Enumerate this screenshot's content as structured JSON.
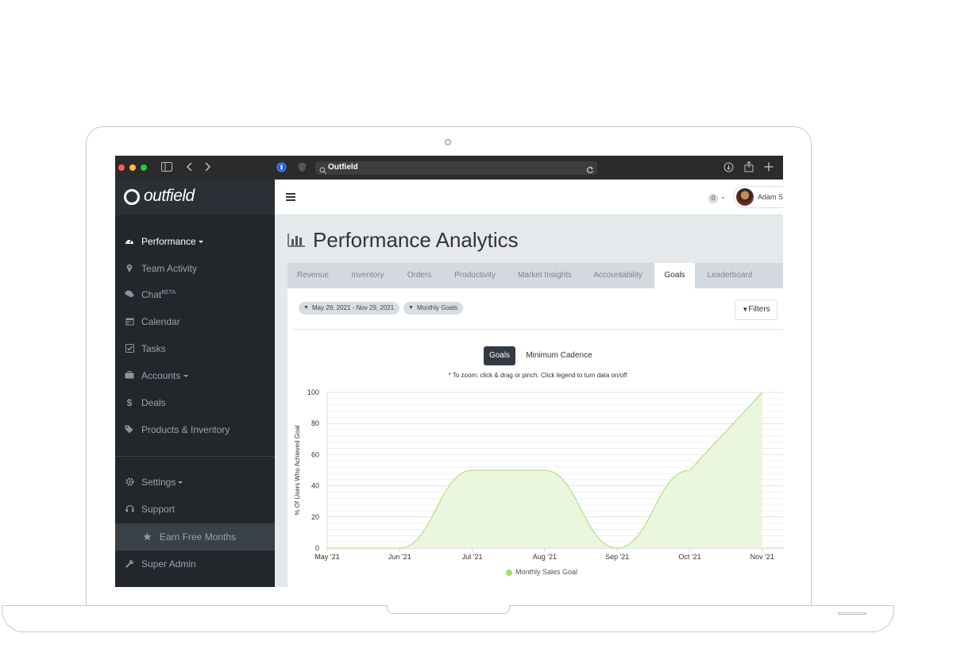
{
  "browser": {
    "url": "Outfield",
    "traffic_lights": [
      "#fe5f57",
      "#febc2e",
      "#28c840"
    ]
  },
  "app": {
    "logo": "outfield",
    "page_title": "Performance Analytics"
  },
  "sidebar": {
    "items": [
      {
        "label": "Performance",
        "icon": "dashboard-icon",
        "active": true,
        "has_caret": true
      },
      {
        "label": "Team Activity",
        "icon": "map-marker-icon",
        "active": false
      },
      {
        "label": "Chat",
        "sup": "BETA",
        "icon": "chat-icon",
        "active": false
      },
      {
        "label": "Calendar",
        "icon": "calendar-icon",
        "active": false
      },
      {
        "label": "Tasks",
        "icon": "checkbox-icon",
        "active": false
      },
      {
        "label": "Accounts",
        "icon": "briefcase-icon",
        "active": false,
        "has_caret": true
      },
      {
        "label": "Deals",
        "icon": "dollar-icon",
        "active": false
      },
      {
        "label": "Products & Inventory",
        "icon": "tags-icon",
        "active": false
      }
    ],
    "bottom_items": [
      {
        "label": "Settings",
        "icon": "gear-icon",
        "has_caret": true
      },
      {
        "label": "Support",
        "icon": "headset-icon"
      },
      {
        "label": "Earn Free Months",
        "icon": "star-icon"
      },
      {
        "label": "Super Admin",
        "icon": "wrench-icon"
      }
    ]
  },
  "topbar": {
    "notifications": "0",
    "user_name": "Adam S"
  },
  "tabs": [
    {
      "label": "Revenue",
      "active": false
    },
    {
      "label": "Inventory",
      "active": false
    },
    {
      "label": "Orders",
      "active": false
    },
    {
      "label": "Productivity",
      "active": false
    },
    {
      "label": "Market Insights",
      "active": false
    },
    {
      "label": "Accountability",
      "active": false
    },
    {
      "label": "Goals",
      "active": true
    },
    {
      "label": "Leaderboard",
      "active": false
    }
  ],
  "filters": {
    "date_range": "May 29, 2021 - Nov 29, 2021",
    "goal_filter": "Monthly Goals",
    "filters_button": "Filters"
  },
  "toggle": {
    "goals": "Goals",
    "cadence": "Minimum Cadence"
  },
  "zoom_note": "* To zoom: click & drag or pinch. Click legend to turn data on/off",
  "colors": {
    "sidebar_bg": "#23272c",
    "series_line": "#a5df6a",
    "series_fill": "#eaf6dd",
    "tab_active_bg": "#ffffff"
  },
  "chart_data": {
    "type": "area",
    "ylabel": "% Of Users Who Achieved Goal",
    "xlabel": "",
    "ylim": [
      0,
      100
    ],
    "yticks": [
      "0",
      "20",
      "40",
      "60",
      "80",
      "100"
    ],
    "x_tick_labels": [
      "May '21",
      "Jun '21",
      "Jul '21",
      "Aug '21",
      "Sep '21",
      "Oct '21",
      "Nov '21"
    ],
    "legend_position": "bottom-center",
    "grid": true,
    "series": [
      {
        "name": "Monthly Sales Goal",
        "x": [
          "May '21",
          "Jun '21",
          "Jul '21",
          "Aug '21",
          "Sep '21",
          "Oct '21",
          "Nov '21"
        ],
        "values": [
          0,
          0,
          50,
          50,
          0,
          50,
          100
        ]
      }
    ]
  }
}
